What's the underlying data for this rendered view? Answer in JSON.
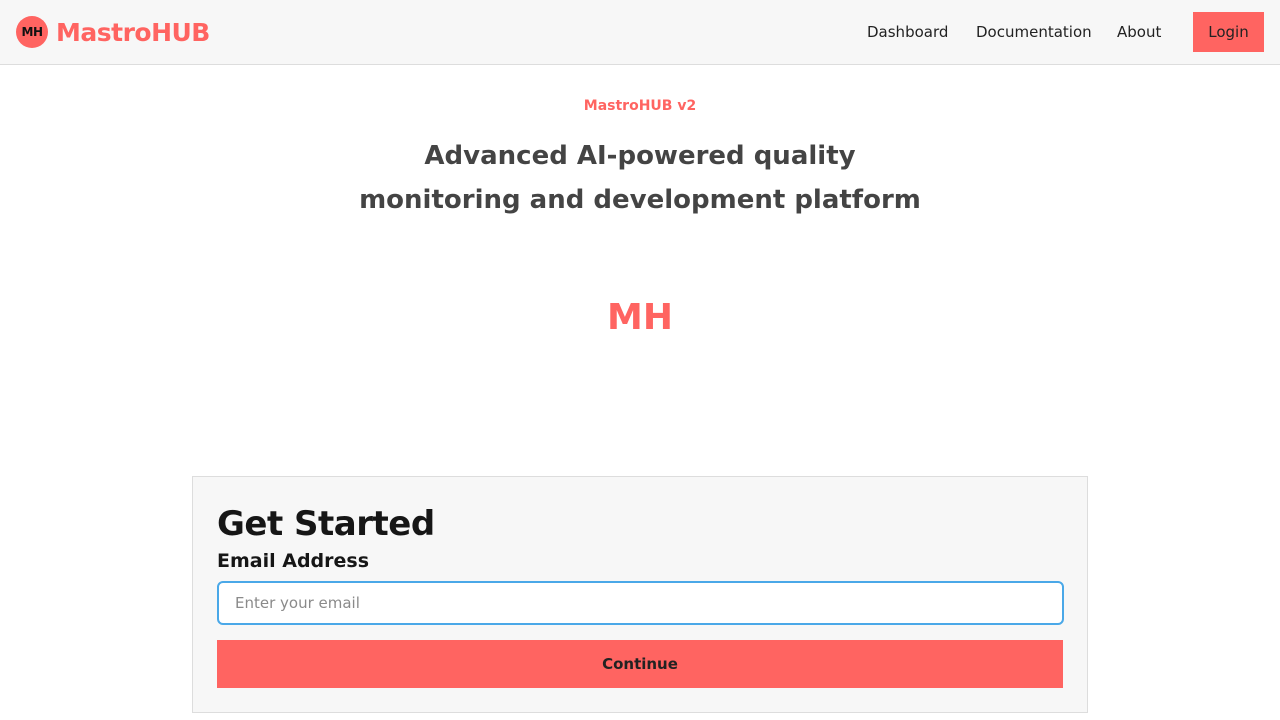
{
  "header": {
    "brand_badge": "MH",
    "brand_name": "MastroHUB",
    "nav": {
      "dashboard": "Dashboard",
      "documentation": "Documentation",
      "about": "About"
    },
    "login_label": "Login"
  },
  "hero": {
    "version": "MastroHUB v2",
    "tagline": "Advanced AI-powered quality monitoring and development platform",
    "mark": "MH"
  },
  "card": {
    "title": "Get Started",
    "email_label": "Email Address",
    "email_placeholder": "Enter your email",
    "email_value": "",
    "continue_label": "Continue"
  },
  "colors": {
    "accent": "#ff6461",
    "header_bg": "#f7f7f7",
    "card_bg": "#f7f7f7",
    "input_focus_border": "#4aa8e8"
  }
}
